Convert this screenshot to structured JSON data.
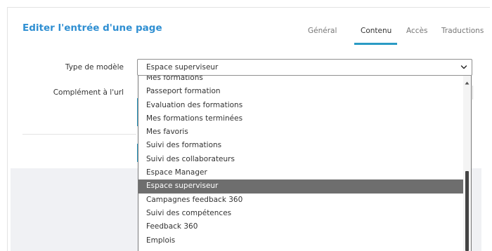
{
  "panel": {
    "title": "Editer l'entrée d'une page"
  },
  "tabs": [
    {
      "label": "Général"
    },
    {
      "label": "Contenu",
      "active": true
    },
    {
      "label": "Accès"
    },
    {
      "label": "Traductions"
    }
  ],
  "form": {
    "template_type_label": "Type de modèle",
    "url_complement_label": "Complément à l'url",
    "template_type_value": "Espace superviseur"
  },
  "dropdown": {
    "options": [
      "Mes formations",
      "Passeport formation",
      "Evaluation des formations",
      "Mes formations terminées",
      "Mes favoris",
      "Suivi des formations",
      "Suivi des collaborateurs",
      "Espace Manager",
      "Espace superviseur",
      "Campagnes feedback 360",
      "Suivi des compétences",
      "Feedback 360",
      "Emplois"
    ],
    "selected": "Espace superviseur"
  },
  "colors": {
    "title": "#2f8fd2",
    "tab_underline": "#2a9bc4",
    "selected_option_bg": "#6e6e6e",
    "page_background": "#f0f1f4"
  },
  "icons": {
    "select_chevron": "chevron-down-icon",
    "scroll_up": "caret-up-icon"
  }
}
